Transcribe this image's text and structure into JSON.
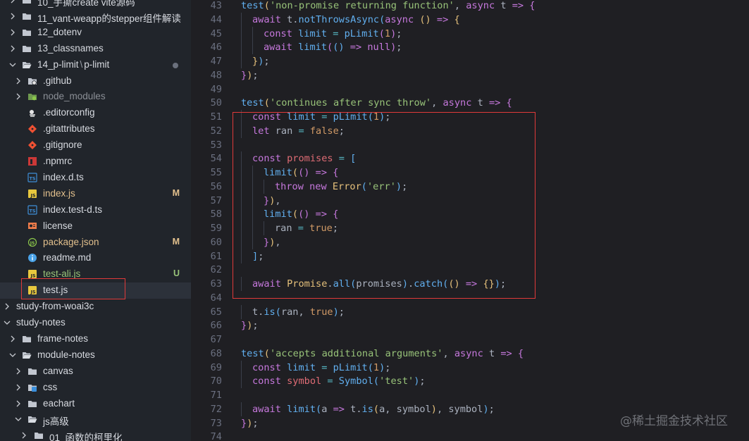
{
  "sidebar": {
    "items": [
      {
        "label": "10_手撕create vite源码",
        "depth": 0,
        "type": "folder",
        "expanded": false
      },
      {
        "label": "11_vant-weapp的stepper组件解读",
        "depth": 0,
        "type": "folder",
        "expanded": false
      },
      {
        "label": "12_dotenv",
        "depth": 0,
        "type": "folder",
        "expanded": false
      },
      {
        "label": "13_classnames",
        "depth": 0,
        "type": "folder",
        "expanded": false
      },
      {
        "label": "14_p-limit",
        "label_sep": "\\",
        "label_suffix": "p-limit",
        "depth": 0,
        "type": "folder-open",
        "expanded": true,
        "dot": true
      },
      {
        "label": ".github",
        "depth": 1,
        "type": "github",
        "expanded": false
      },
      {
        "label": "node_modules",
        "depth": 1,
        "type": "node",
        "expanded": false,
        "dim": true
      },
      {
        "label": ".editorconfig",
        "depth": 1,
        "type": "editorconfig"
      },
      {
        "label": ".gitattributes",
        "depth": 1,
        "type": "git"
      },
      {
        "label": ".gitignore",
        "depth": 1,
        "type": "git"
      },
      {
        "label": ".npmrc",
        "depth": 1,
        "type": "npm"
      },
      {
        "label": "index.d.ts",
        "depth": 1,
        "type": "ts"
      },
      {
        "label": "index.js",
        "depth": 1,
        "type": "js",
        "status": "M",
        "modified": true
      },
      {
        "label": "index.test-d.ts",
        "depth": 1,
        "type": "ts"
      },
      {
        "label": "license",
        "depth": 1,
        "type": "license"
      },
      {
        "label": "package.json",
        "depth": 1,
        "type": "json",
        "status": "M",
        "modified": true
      },
      {
        "label": "readme.md",
        "depth": 1,
        "type": "info"
      },
      {
        "label": "test-ali.js",
        "depth": 1,
        "type": "js",
        "status": "U",
        "untracked": true
      },
      {
        "label": "test.js",
        "depth": 1,
        "type": "js",
        "selected": true
      },
      {
        "label": "study-from-woai3c",
        "depth": -1,
        "type": "none",
        "expanded": false
      },
      {
        "label": "study-notes",
        "depth": -1,
        "type": "none",
        "expanded": true
      },
      {
        "label": "frame-notes",
        "depth": 0,
        "type": "folder",
        "expanded": false
      },
      {
        "label": "module-notes",
        "depth": 0,
        "type": "folder-open",
        "expanded": true
      },
      {
        "label": "canvas",
        "depth": 1,
        "type": "folder",
        "expanded": false
      },
      {
        "label": "css",
        "depth": 1,
        "type": "css-folder",
        "expanded": false
      },
      {
        "label": "eachart",
        "depth": 1,
        "type": "folder",
        "expanded": false
      },
      {
        "label": "js高级",
        "depth": 1,
        "type": "folder-open",
        "expanded": true
      },
      {
        "label": "01_函数的柯里化",
        "depth": 2,
        "type": "folder",
        "expanded": false
      }
    ]
  },
  "editor": {
    "lines": [
      {
        "n": "43",
        "i": 0,
        "t": [
          [
            "fn",
            "test"
          ],
          [
            "b1",
            "("
          ],
          [
            "str",
            "'non-promise returning function'"
          ],
          [
            "p",
            ", "
          ],
          [
            "kw",
            "async"
          ],
          [
            "p",
            " t "
          ],
          [
            "kw",
            "=>"
          ],
          [
            "p",
            " "
          ],
          [
            "b2",
            "{"
          ]
        ]
      },
      {
        "n": "44",
        "i": 1,
        "t": [
          [
            "kw",
            "await"
          ],
          [
            "p",
            " t."
          ],
          [
            "fn",
            "notThrowsAsync"
          ],
          [
            "b3",
            "("
          ],
          [
            "kw",
            "async"
          ],
          [
            "p",
            " "
          ],
          [
            "b1",
            "()"
          ],
          [
            "p",
            " "
          ],
          [
            "kw",
            "=>"
          ],
          [
            "p",
            " "
          ],
          [
            "b1",
            "{"
          ]
        ]
      },
      {
        "n": "45",
        "i": 2,
        "t": [
          [
            "kw",
            "const"
          ],
          [
            "p",
            " "
          ],
          [
            "fn",
            "limit"
          ],
          [
            "p",
            " "
          ],
          [
            "op",
            "="
          ],
          [
            "p",
            " "
          ],
          [
            "fn",
            "pLimit"
          ],
          [
            "b2",
            "("
          ],
          [
            "num",
            "1"
          ],
          [
            "b2",
            ")"
          ],
          [
            "p",
            ";"
          ]
        ]
      },
      {
        "n": "46",
        "i": 2,
        "t": [
          [
            "kw",
            "await"
          ],
          [
            "p",
            " "
          ],
          [
            "fn",
            "limit"
          ],
          [
            "b2",
            "("
          ],
          [
            "b3",
            "()"
          ],
          [
            "p",
            " "
          ],
          [
            "kw",
            "=>"
          ],
          [
            "p",
            " "
          ],
          [
            "kw",
            "null"
          ],
          [
            "b2",
            ")"
          ],
          [
            "p",
            ";"
          ]
        ]
      },
      {
        "n": "47",
        "i": 1,
        "t": [
          [
            "b1",
            "}"
          ],
          [
            "b3",
            ")"
          ],
          [
            "p",
            ";"
          ]
        ]
      },
      {
        "n": "48",
        "i": 0,
        "t": [
          [
            "b2",
            "}"
          ],
          [
            "b1",
            ")"
          ],
          [
            "p",
            ";"
          ]
        ]
      },
      {
        "n": "49",
        "i": 0,
        "t": []
      },
      {
        "n": "50",
        "i": 0,
        "t": [
          [
            "fn",
            "test"
          ],
          [
            "b1",
            "("
          ],
          [
            "str",
            "'continues after sync throw'"
          ],
          [
            "p",
            ", "
          ],
          [
            "kw",
            "async"
          ],
          [
            "p",
            " t "
          ],
          [
            "kw",
            "=>"
          ],
          [
            "p",
            " "
          ],
          [
            "b2",
            "{"
          ]
        ]
      },
      {
        "n": "51",
        "i": 1,
        "t": [
          [
            "kw",
            "const"
          ],
          [
            "p",
            " "
          ],
          [
            "fn",
            "limit"
          ],
          [
            "p",
            " "
          ],
          [
            "op",
            "="
          ],
          [
            "p",
            " "
          ],
          [
            "fn",
            "pLimit"
          ],
          [
            "b3",
            "("
          ],
          [
            "num",
            "1"
          ],
          [
            "b3",
            ")"
          ],
          [
            "p",
            ";"
          ]
        ]
      },
      {
        "n": "52",
        "i": 1,
        "t": [
          [
            "kw",
            "let"
          ],
          [
            "p",
            " ran "
          ],
          [
            "op",
            "="
          ],
          [
            "p",
            " "
          ],
          [
            "num",
            "false"
          ],
          [
            "p",
            ";"
          ]
        ]
      },
      {
        "n": "53",
        "i": 0,
        "t": []
      },
      {
        "n": "54",
        "i": 1,
        "t": [
          [
            "kw",
            "const"
          ],
          [
            "p",
            " "
          ],
          [
            "var",
            "promises"
          ],
          [
            "p",
            " "
          ],
          [
            "op",
            "="
          ],
          [
            "p",
            " "
          ],
          [
            "b3",
            "["
          ]
        ]
      },
      {
        "n": "55",
        "i": 2,
        "t": [
          [
            "fn",
            "limit"
          ],
          [
            "b1",
            "("
          ],
          [
            "b2",
            "()"
          ],
          [
            "p",
            " "
          ],
          [
            "kw",
            "=>"
          ],
          [
            "p",
            " "
          ],
          [
            "b2",
            "{"
          ]
        ]
      },
      {
        "n": "56",
        "i": 3,
        "t": [
          [
            "kw",
            "throw"
          ],
          [
            "p",
            " "
          ],
          [
            "kw",
            "new"
          ],
          [
            "p",
            " "
          ],
          [
            "cls",
            "Error"
          ],
          [
            "b3",
            "("
          ],
          [
            "str",
            "'err'"
          ],
          [
            "b3",
            ")"
          ],
          [
            "p",
            ";"
          ]
        ]
      },
      {
        "n": "57",
        "i": 2,
        "t": [
          [
            "b2",
            "}"
          ],
          [
            "b1",
            ")"
          ],
          [
            "p",
            ","
          ]
        ]
      },
      {
        "n": "58",
        "i": 2,
        "t": [
          [
            "fn",
            "limit"
          ],
          [
            "b1",
            "("
          ],
          [
            "b2",
            "()"
          ],
          [
            "p",
            " "
          ],
          [
            "kw",
            "=>"
          ],
          [
            "p",
            " "
          ],
          [
            "b2",
            "{"
          ]
        ]
      },
      {
        "n": "59",
        "i": 3,
        "t": [
          [
            "p",
            "ran "
          ],
          [
            "op",
            "="
          ],
          [
            "p",
            " "
          ],
          [
            "num",
            "true"
          ],
          [
            "p",
            ";"
          ]
        ]
      },
      {
        "n": "60",
        "i": 2,
        "t": [
          [
            "b2",
            "}"
          ],
          [
            "b1",
            ")"
          ],
          [
            "p",
            ","
          ]
        ]
      },
      {
        "n": "61",
        "i": 1,
        "t": [
          [
            "b3",
            "]"
          ],
          [
            "p",
            ";"
          ]
        ]
      },
      {
        "n": "62",
        "i": 0,
        "t": []
      },
      {
        "n": "63",
        "i": 1,
        "t": [
          [
            "kw",
            "await"
          ],
          [
            "p",
            " "
          ],
          [
            "cls",
            "Promise"
          ],
          [
            "p",
            "."
          ],
          [
            "fn",
            "all"
          ],
          [
            "b3",
            "("
          ],
          [
            "p",
            "promises"
          ],
          [
            "b3",
            ")"
          ],
          [
            "p",
            "."
          ],
          [
            "fn",
            "catch"
          ],
          [
            "b3",
            "("
          ],
          [
            "b1",
            "()"
          ],
          [
            "p",
            " "
          ],
          [
            "kw",
            "=>"
          ],
          [
            "p",
            " "
          ],
          [
            "b1",
            "{}"
          ],
          [
            "b3",
            ")"
          ],
          [
            "p",
            ";"
          ]
        ]
      },
      {
        "n": "64",
        "i": 0,
        "t": []
      },
      {
        "n": "65",
        "i": 1,
        "t": [
          [
            "p",
            "t."
          ],
          [
            "fn",
            "is"
          ],
          [
            "b3",
            "("
          ],
          [
            "p",
            "ran, "
          ],
          [
            "num",
            "true"
          ],
          [
            "b3",
            ")"
          ],
          [
            "p",
            ";"
          ]
        ]
      },
      {
        "n": "66",
        "i": 0,
        "t": [
          [
            "b2",
            "}"
          ],
          [
            "b1",
            ")"
          ],
          [
            "p",
            ";"
          ]
        ]
      },
      {
        "n": "67",
        "i": 0,
        "t": []
      },
      {
        "n": "68",
        "i": 0,
        "t": [
          [
            "fn",
            "test"
          ],
          [
            "b1",
            "("
          ],
          [
            "str",
            "'accepts additional arguments'"
          ],
          [
            "p",
            ", "
          ],
          [
            "kw",
            "async"
          ],
          [
            "p",
            " t "
          ],
          [
            "kw",
            "=>"
          ],
          [
            "p",
            " "
          ],
          [
            "b2",
            "{"
          ]
        ]
      },
      {
        "n": "69",
        "i": 1,
        "t": [
          [
            "kw",
            "const"
          ],
          [
            "p",
            " "
          ],
          [
            "fn",
            "limit"
          ],
          [
            "p",
            " "
          ],
          [
            "op",
            "="
          ],
          [
            "p",
            " "
          ],
          [
            "fn",
            "pLimit"
          ],
          [
            "b3",
            "("
          ],
          [
            "num",
            "1"
          ],
          [
            "b3",
            ")"
          ],
          [
            "p",
            ";"
          ]
        ]
      },
      {
        "n": "70",
        "i": 1,
        "t": [
          [
            "kw",
            "const"
          ],
          [
            "p",
            " "
          ],
          [
            "var",
            "symbol"
          ],
          [
            "p",
            " "
          ],
          [
            "op",
            "="
          ],
          [
            "p",
            " "
          ],
          [
            "fn",
            "Symbol"
          ],
          [
            "b3",
            "("
          ],
          [
            "str",
            "'test'"
          ],
          [
            "b3",
            ")"
          ],
          [
            "p",
            ";"
          ]
        ]
      },
      {
        "n": "71",
        "i": 0,
        "t": []
      },
      {
        "n": "72",
        "i": 1,
        "t": [
          [
            "kw",
            "await"
          ],
          [
            "p",
            " "
          ],
          [
            "fn",
            "limit"
          ],
          [
            "b3",
            "("
          ],
          [
            "p",
            "a "
          ],
          [
            "kw",
            "=>"
          ],
          [
            "p",
            " t."
          ],
          [
            "fn",
            "is"
          ],
          [
            "b1",
            "("
          ],
          [
            "p",
            "a, symbol"
          ],
          [
            "b1",
            ")"
          ],
          [
            "p",
            ", symbol"
          ],
          [
            "b3",
            ")"
          ],
          [
            "p",
            ";"
          ]
        ]
      },
      {
        "n": "73",
        "i": 0,
        "t": [
          [
            "b2",
            "}"
          ],
          [
            "b1",
            ")"
          ],
          [
            "p",
            ";"
          ]
        ]
      },
      {
        "n": "74",
        "i": 0,
        "t": []
      }
    ]
  },
  "watermark": "@稀土掘金技术社区"
}
